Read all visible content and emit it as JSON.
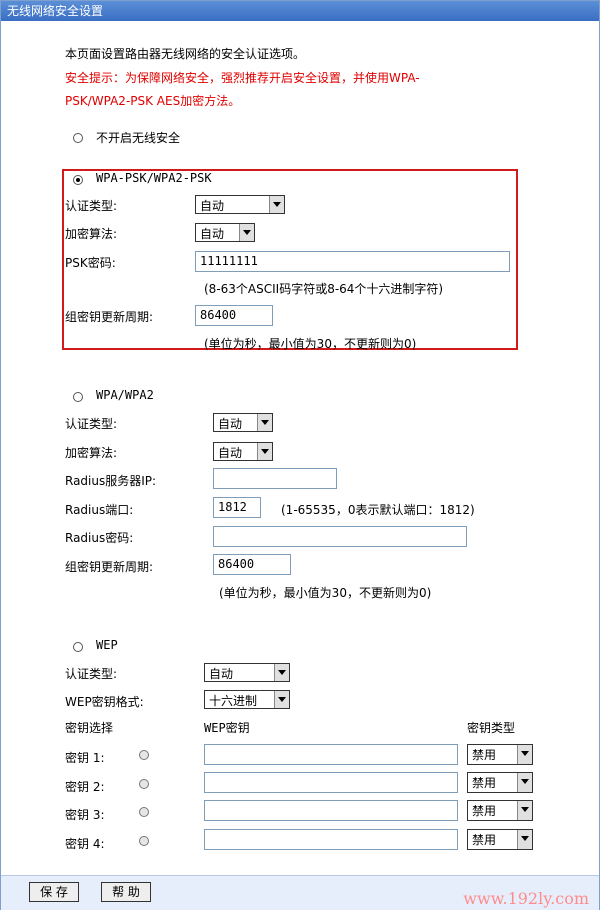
{
  "page_title": "无线网络安全设置",
  "intro": {
    "desc": "本页面设置路由器无线网络的安全认证选项。",
    "tip_line1": "安全提示：为保障网络安全，强烈推荐开启安全设置，并使用WPA-",
    "tip_line2": "PSK/WPA2-PSK AES加密方法。"
  },
  "option_none": {
    "label": "不开启无线安全",
    "selected": false
  },
  "wpa_psk": {
    "label": "WPA-PSK/WPA2-PSK",
    "selected": true,
    "auth_label": "认证类型:",
    "auth_value": "自动",
    "cipher_label": "加密算法:",
    "cipher_value": "自动",
    "psk_label": "PSK密码:",
    "psk_value": "11111111",
    "psk_hint": "(8-63个ASCII码字符或8-64个十六进制字符)",
    "group_label": "组密钥更新周期:",
    "group_value": "86400",
    "group_hint": "(单位为秒，最小值为30，不更新则为0)"
  },
  "wpa": {
    "label": "WPA/WPA2",
    "selected": false,
    "auth_label": "认证类型:",
    "auth_value": "自动",
    "cipher_label": "加密算法:",
    "cipher_value": "自动",
    "radius_ip_label": "Radius服务器IP:",
    "radius_ip_value": "",
    "radius_port_label": "Radius端口:",
    "radius_port_value": "1812",
    "radius_port_hint": "(1-65535，0表示默认端口：1812)",
    "radius_pwd_label": "Radius密码:",
    "radius_pwd_value": "",
    "group_label": "组密钥更新周期:",
    "group_value": "86400",
    "group_hint": "(单位为秒，最小值为30，不更新则为0)"
  },
  "wep": {
    "label": "WEP",
    "selected": false,
    "auth_label": "认证类型:",
    "auth_value": "自动",
    "format_label": "WEP密钥格式:",
    "format_value": "十六进制",
    "col_select": "密钥选择",
    "col_key": "WEP密钥",
    "col_type": "密钥类型",
    "keys": [
      {
        "label": "密钥 1:",
        "value": "",
        "type": "禁用"
      },
      {
        "label": "密钥 2:",
        "value": "",
        "type": "禁用"
      },
      {
        "label": "密钥 3:",
        "value": "",
        "type": "禁用"
      },
      {
        "label": "密钥 4:",
        "value": "",
        "type": "禁用"
      }
    ]
  },
  "buttons": {
    "save": "保 存",
    "help": "帮 助"
  },
  "watermark": "www.192ly.com",
  "colors": {
    "title_bar": "#3a6ec4",
    "warning": "#e00000",
    "highlight_box": "#d21a1a",
    "footer": "#e6eefb"
  }
}
